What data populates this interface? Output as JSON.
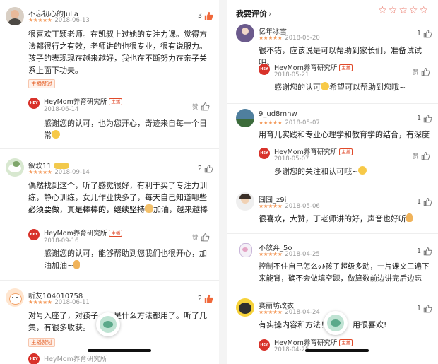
{
  "left": {
    "comments": [
      {
        "user": "不忘初心的Julia",
        "date": "2018-06-13",
        "likes": "3",
        "body_lines": [
          "很喜欢丁颖老师。在凯叔上过她的专注力课。觉得方",
          "法都很行之有效，老师讲的也很专业，很有说服力。",
          "孩子的表现现在越来越好，我也在不断努力在亲子关",
          "系上面下功夫。"
        ],
        "badge": "主播赞过",
        "reply": {
          "name": "HeyMom养育研究所",
          "official": "主播",
          "date": "2018-06-14",
          "like_label": "赞",
          "lines": [
            "感谢您的认可，也为您开心，奇迹来自每一个日",
            "常"
          ]
        }
      },
      {
        "user": "叙欢11",
        "date": "2018-09-14",
        "likes": "2",
        "body_lines": [
          "偶然找到这个，听了感觉很好，有利于买了专注力训",
          "练，静心训练，女儿作业快多了，每天自己知道哪些",
          "必须要做，真是棒棒的，继续坚持",
          "加油，越来越棒"
        ],
        "reply": {
          "name": "HeyMom养育研究所",
          "official": "主播",
          "date": "2018-09-16",
          "like_label": "赞",
          "lines": [
            "感谢您的认可，能够帮助到您我们也很开心，加",
            "油加油~"
          ]
        }
      },
      {
        "user": "听友104010758",
        "date": "2018-06-11",
        "likes": "2",
        "body_lines": [
          "对号入座了，对孩子",
          "是什么方法都用了。听了几",
          "集，有很多收获。"
        ],
        "badge": "主播赞过",
        "reply": {
          "name": "HeyMom养育研究所"
        }
      }
    ]
  },
  "right": {
    "section_title": "我要评价",
    "section_chevron": "›",
    "rating_stars": "☆☆☆☆☆",
    "comments": [
      {
        "user": "亿年冰雪",
        "date": "2018-05-20",
        "likes": "1",
        "body_lines": [
          "很不错，应该说是可以帮助到家长们，准备试试吧。"
        ],
        "reply": {
          "name": "HeyMom养育研究所",
          "official": "主播",
          "date": "2018-05-21",
          "like_label": "赞",
          "lines": [
            "感谢您的认可",
            "希望可以帮助到您哦~"
          ]
        }
      },
      {
        "user": "9_ud8mhw",
        "date": "2018-05-07",
        "likes": "1",
        "body_lines": [
          "用育儿实践和专业心理学和教育学的结合，有深度"
        ],
        "reply": {
          "name": "HeyMom养育研究所",
          "official": "主播",
          "date": "2018-05-07",
          "like_label": "赞",
          "lines": [
            "多谢您的关注和认可哦~"
          ]
        }
      },
      {
        "user": "囧囧_z9i",
        "date": "2018-05-06",
        "likes": "1",
        "body_lines": [
          "很喜欢，大赞，丁老师讲的好，声音也好听"
        ]
      },
      {
        "user": "不放弃_5o",
        "date": "2018-04-25",
        "likes": "1",
        "body_lines": [
          "控制不住自己怎么办孩子超级多动，一片课文三遍下",
          "来能背，确不会做填空题，做算数前边讲完后边忘"
        ]
      },
      {
        "user": "赛丽坊改衣",
        "date": "2018-04-24",
        "likes": "1",
        "body_lines": [
          "有实操内容和方法！",
          "用很喜欢!"
        ],
        "reply": {
          "name": "HeyMom养育研究所",
          "official": "主播",
          "date": "2018-04-25"
        }
      }
    ]
  },
  "icons": {
    "thumb": "thumbs-up-icon",
    "star": "star-icon"
  },
  "colors": {
    "accent": "#f39a5b",
    "brand_red": "#d8322a",
    "like_orange": "#f0683a"
  }
}
